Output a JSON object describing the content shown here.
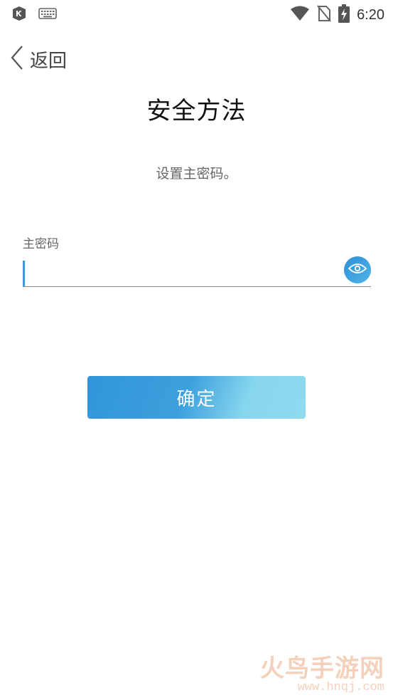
{
  "status_bar": {
    "time": "6:20",
    "left_icons": [
      "app-notification-icon",
      "keyboard-icon"
    ],
    "right_icons": [
      "wifi-icon",
      "no-sim-icon",
      "battery-charging-icon"
    ]
  },
  "header": {
    "back_label": "返回"
  },
  "page": {
    "title": "安全方法",
    "subtitle": "设置主密码。"
  },
  "form": {
    "field_label": "主密码",
    "password_value": "",
    "password_placeholder": ""
  },
  "actions": {
    "confirm_label": "确定"
  },
  "colors": {
    "accent": "#3a9bd6",
    "button_gradient_start": "#3196d9",
    "button_gradient_end": "#8fdaef"
  },
  "watermark": {
    "logo_text": "火鸟手游网",
    "url": "www.hnqj.com"
  }
}
